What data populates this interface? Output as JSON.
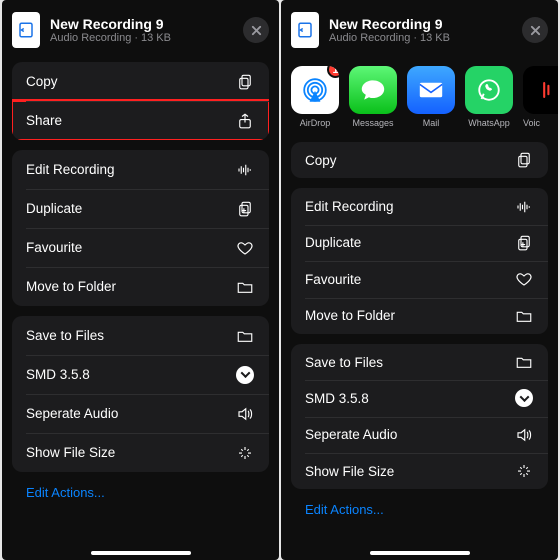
{
  "doc": {
    "title": "New Recording 9",
    "type": "Audio Recording",
    "size": "13 KB"
  },
  "apps": {
    "airdrop": {
      "label": "AirDrop",
      "badge": "1"
    },
    "messages": {
      "label": "Messages"
    },
    "mail": {
      "label": "Mail"
    },
    "whatsapp": {
      "label": "WhatsApp"
    },
    "voice": {
      "label": "Voic"
    }
  },
  "menu": {
    "copy": "Copy",
    "share": "Share",
    "edit_recording": "Edit Recording",
    "duplicate": "Duplicate",
    "favourite": "Favourite",
    "move_to_folder": "Move to Folder",
    "save_to_files": "Save to Files",
    "smd": "SMD 3.5.8",
    "seperate_audio": "Seperate Audio",
    "show_file_size": "Show File Size",
    "edit_actions": "Edit Actions..."
  }
}
